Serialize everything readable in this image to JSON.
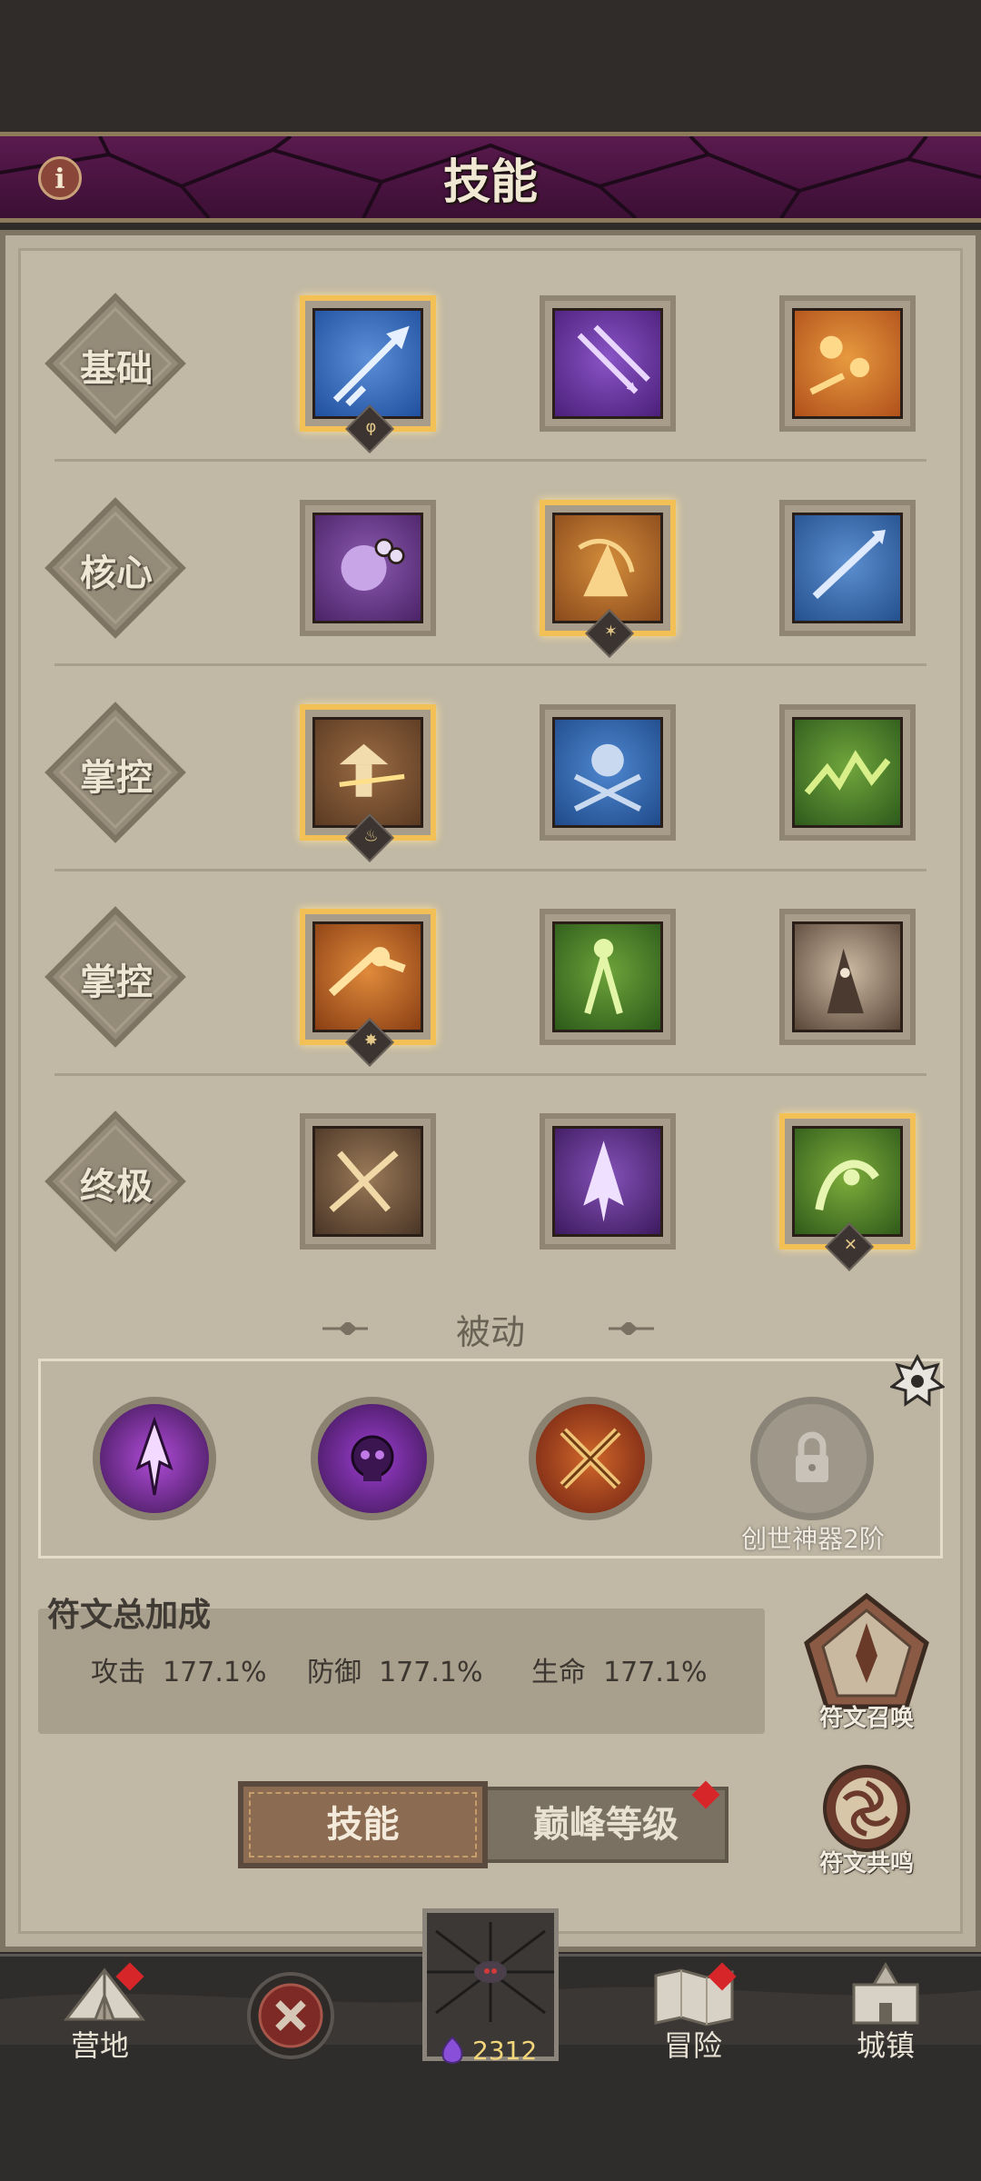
{
  "header": {
    "title": "技能",
    "info_label": "i"
  },
  "categories": [
    {
      "label": "基础",
      "skills": [
        {
          "name": "blue-arrow-skill",
          "selected": true,
          "colors": [
            "#1f4f9e",
            "#5d8fd8"
          ]
        },
        {
          "name": "purple-arrows-skill",
          "selected": false,
          "colors": [
            "#4b1f7a",
            "#8a55c6"
          ]
        },
        {
          "name": "orange-shots-skill",
          "selected": false,
          "colors": [
            "#b0501b",
            "#e89a3f"
          ]
        }
      ]
    },
    {
      "label": "核心",
      "skills": [
        {
          "name": "purple-creature-skill",
          "selected": false,
          "colors": [
            "#4b2367",
            "#8b5ab0"
          ]
        },
        {
          "name": "orange-archer-skill",
          "selected": true,
          "colors": [
            "#8a4a1c",
            "#d48d3b"
          ]
        },
        {
          "name": "blue-spear-skill",
          "selected": false,
          "colors": [
            "#24508e",
            "#5d8fd0"
          ]
        }
      ]
    },
    {
      "label": "掌控",
      "skills": [
        {
          "name": "brown-tower-skill",
          "selected": true,
          "colors": [
            "#5a3a22",
            "#9a6b43"
          ]
        },
        {
          "name": "blue-hooded-skill",
          "selected": false,
          "colors": [
            "#1f4a8a",
            "#4f88d0"
          ]
        },
        {
          "name": "green-thorn-skill",
          "selected": false,
          "colors": [
            "#2d5a1c",
            "#71a63c"
          ]
        }
      ]
    },
    {
      "label": "掌控",
      "skills": [
        {
          "name": "orange-dash-skill",
          "selected": true,
          "colors": [
            "#8a3f14",
            "#e08a3b"
          ]
        },
        {
          "name": "green-warrior-skill",
          "selected": false,
          "colors": [
            "#2c5a1a",
            "#6da33a"
          ]
        },
        {
          "name": "hooded-figure-skill",
          "selected": false,
          "colors": [
            "#5a4638",
            "#cbbaa3"
          ]
        }
      ]
    },
    {
      "label": "终极",
      "skills": [
        {
          "name": "crossbow-skill",
          "selected": false,
          "colors": [
            "#4a3526",
            "#9a7a58"
          ]
        },
        {
          "name": "purple-lightning-arrow-skill",
          "selected": false,
          "colors": [
            "#3d1a5e",
            "#8452b8"
          ]
        },
        {
          "name": "green-beast-skill",
          "selected": true,
          "colors": [
            "#2f5a1a",
            "#7fae3c"
          ]
        }
      ]
    }
  ],
  "passive": {
    "title": "被动",
    "items": [
      {
        "name": "passive-arrow",
        "colors": [
          "#3a1550",
          "#b04cd8"
        ]
      },
      {
        "name": "passive-skull",
        "colors": [
          "#3a1550",
          "#9c3ed0"
        ]
      },
      {
        "name": "passive-swords",
        "colors": [
          "#6e1f12",
          "#d0672a"
        ]
      }
    ],
    "locked_label": "创世神器2阶"
  },
  "runes": {
    "title": "符文总加成",
    "stats": [
      {
        "label": "攻击",
        "value": "177.1%"
      },
      {
        "label": "防御",
        "value": "177.1%"
      },
      {
        "label": "生命",
        "value": "177.1%"
      }
    ],
    "summon_label": "符文召唤",
    "resonance_label": "符文共鸣"
  },
  "tabs": {
    "active": "技能",
    "inactive": "巅峰等级"
  },
  "nav": {
    "camp": "营地",
    "adventure": "冒险",
    "town": "城镇",
    "gem_count": "2312"
  },
  "colors": {
    "header": "#4a1340",
    "panel": "#c1b8a5",
    "selected_border": "#f2c054",
    "alert": "#d7262a",
    "gem_text": "#f4d67a"
  }
}
